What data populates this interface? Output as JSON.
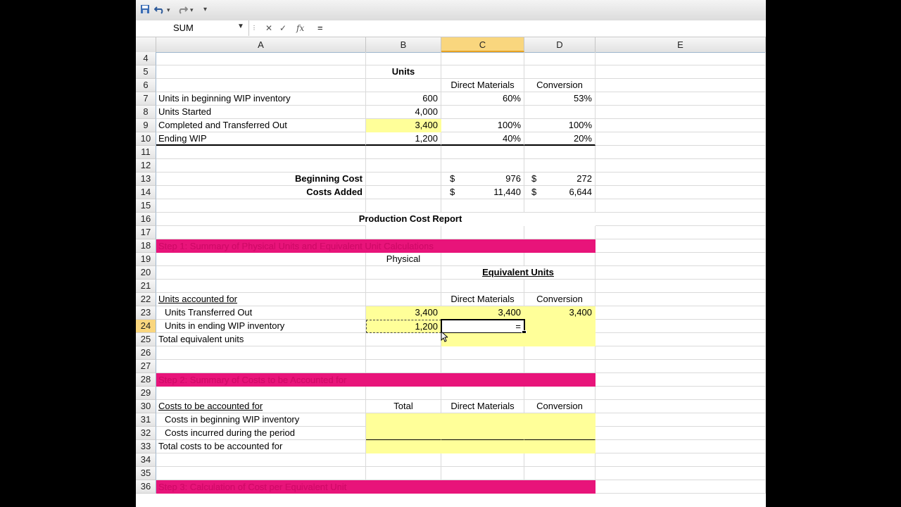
{
  "toolbar": {
    "save_icon": "save-icon",
    "undo_icon": "undo-icon",
    "redo_icon": "redo-icon",
    "customize_label": "▾"
  },
  "formula_bar": {
    "name_box": "SUM",
    "cancel": "✕",
    "enter": "✓",
    "fx": "fx",
    "formula": "="
  },
  "columns": [
    "A",
    "B",
    "C",
    "D",
    "E"
  ],
  "selected_column": "C",
  "rows": {
    "r4": {
      "num": "4"
    },
    "r5": {
      "num": "5",
      "b": "Units"
    },
    "r6": {
      "num": "6",
      "c": "Direct Materials",
      "d": "Conversion"
    },
    "r7": {
      "num": "7",
      "a": "Units in beginning WIP inventory",
      "b": "600",
      "c": "60%",
      "d": "53%"
    },
    "r8": {
      "num": "8",
      "a": "Units Started",
      "b": "4,000"
    },
    "r9": {
      "num": "9",
      "a": "Completed and Transferred Out",
      "b": "3,400",
      "c": "100%",
      "d": "100%"
    },
    "r10": {
      "num": "10",
      "a": "Ending WIP",
      "b": "1,200",
      "c": "40%",
      "d": "20%"
    },
    "r11": {
      "num": "11"
    },
    "r12": {
      "num": "12"
    },
    "r13": {
      "num": "13",
      "a": "Beginning Cost",
      "c_cur": "$",
      "c": "976",
      "d_cur": "$",
      "d": "272"
    },
    "r14": {
      "num": "14",
      "a": "Costs Added",
      "c_cur": "$",
      "c": "11,440",
      "d_cur": "$",
      "d": "6,644"
    },
    "r15": {
      "num": "15"
    },
    "r16": {
      "num": "16",
      "title": "Production Cost Report"
    },
    "r17": {
      "num": "17"
    },
    "r18": {
      "num": "18",
      "band": "Step 1: Summary of Physical Units and Equivalent Unit Calculations"
    },
    "r19": {
      "num": "19",
      "b": "Physical"
    },
    "r20": {
      "num": "20",
      "cd": "Equivalent Units"
    },
    "r21": {
      "num": "21"
    },
    "r22": {
      "num": "22",
      "a": "Units accounted for",
      "c": "Direct Materials",
      "d": "Conversion"
    },
    "r23": {
      "num": "23",
      "a": "Units Transferred Out",
      "b": "3,400",
      "c": "3,400",
      "d": "3,400"
    },
    "r24": {
      "num": "24",
      "a": "Units in ending WIP inventory",
      "b": "1,200",
      "c": "="
    },
    "r25": {
      "num": "25",
      "a": "Total equivalent units"
    },
    "r26": {
      "num": "26"
    },
    "r27": {
      "num": "27"
    },
    "r28": {
      "num": "28",
      "band": "Step 2: Summary of Costs to be Accounted for"
    },
    "r29": {
      "num": "29"
    },
    "r30": {
      "num": "30",
      "a": "Costs to be accounted for",
      "b": "Total",
      "c": "Direct Materials",
      "d": "Conversion"
    },
    "r31": {
      "num": "31",
      "a": "Costs in beginning WIP inventory"
    },
    "r32": {
      "num": "32",
      "a": "Costs incurred during the period"
    },
    "r33": {
      "num": "33",
      "a": "Total costs to be accounted for"
    },
    "r34": {
      "num": "34"
    },
    "r35": {
      "num": "35"
    },
    "r36": {
      "num": "36",
      "band": "Step 3: Calculation of Cost per Equivalent Unit"
    }
  }
}
